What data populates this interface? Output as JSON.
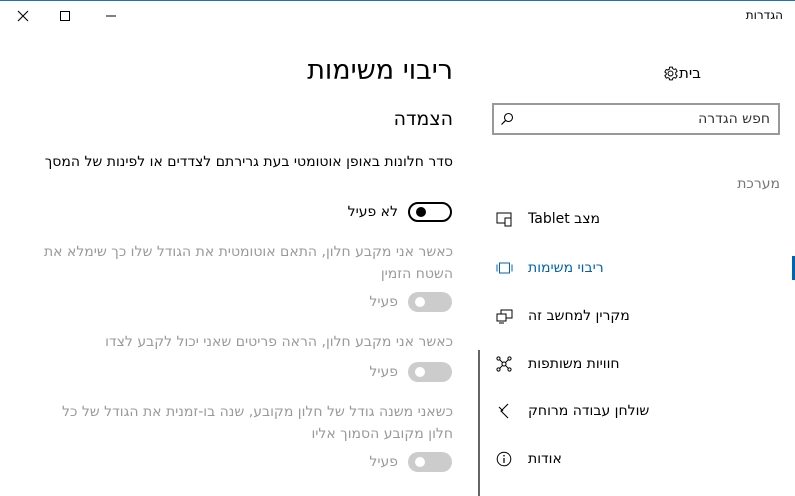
{
  "window": {
    "title": "הגדרות",
    "accent": "#0063b1"
  },
  "nav": {
    "home_label": "בית",
    "search_placeholder": "חפש הגדרה",
    "section_header": "מערכת",
    "items": [
      {
        "label": "מצב Tablet",
        "icon": "tablet-mode-icon"
      },
      {
        "label": "ריבוי משימות",
        "icon": "multitasking-icon",
        "active": true
      },
      {
        "label": "מקרין למחשב זה",
        "icon": "projecting-icon"
      },
      {
        "label": "חוויות משותפות",
        "icon": "shared-experiences-icon"
      },
      {
        "label": "שולחן עבודה מרוחק",
        "icon": "remote-desktop-icon"
      },
      {
        "label": "אודות",
        "icon": "info-icon"
      }
    ]
  },
  "main": {
    "title": "ריבוי משימות",
    "snap_group_title": "הצמדה",
    "settings": [
      {
        "description": "סדר חלונות באופן אוטומטי בעת גרירתם לצדדים או לפינות של המסך",
        "state_label": "לא פעיל",
        "enabled": true
      },
      {
        "description": "כאשר אני מקבע חלון, התאם אוטומטית את הגודל שלו כך שימלא את השטח הזמין",
        "state_label": "פעיל",
        "enabled": false
      },
      {
        "description": "כאשר אני מקבע חלון, הראה פריטים שאני יכול לקבע לצדו",
        "state_label": "פעיל",
        "enabled": false
      },
      {
        "description": "כשאני משנה גודל של חלון מקובע, שנה בו-זמנית את הגודל של כל חלון מקובע הסמוך אליו",
        "state_label": "פעיל",
        "enabled": false
      }
    ]
  }
}
